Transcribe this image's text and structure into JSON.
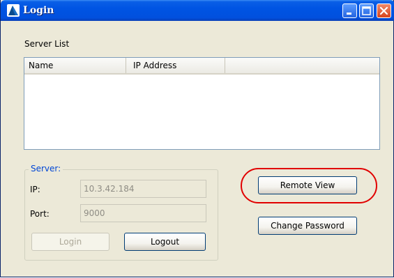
{
  "window": {
    "title": "Login"
  },
  "server_list": {
    "label": "Server List",
    "columns": [
      "Name",
      "IP Address"
    ],
    "rows": []
  },
  "server": {
    "group_label": "Server:",
    "ip_label": "IP:",
    "ip_value": "10.3.42.184",
    "port_label": "Port:",
    "port_value": "9000"
  },
  "buttons": {
    "login": "Login",
    "logout": "Logout",
    "remote_view": "Remote View",
    "change_password": "Change Password"
  },
  "colors": {
    "titlebar": "#0054e3",
    "highlight": "#e10000",
    "group_label": "#0046d5"
  },
  "icons": {
    "app": "app-logo-icon",
    "minimize": "minimize-icon",
    "maximize": "maximize-icon",
    "close": "close-icon"
  }
}
